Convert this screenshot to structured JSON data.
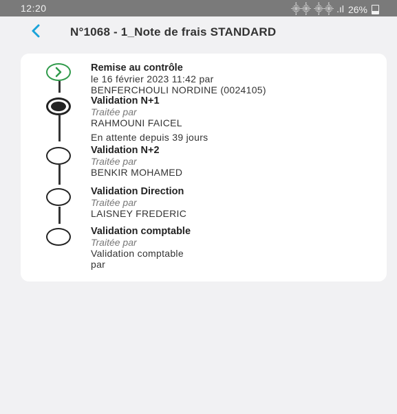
{
  "status_bar": {
    "time": "12:20",
    "indicators": "⸎⸎ ⸎⸎ .ıl 26%",
    "battery": "26%"
  },
  "header": {
    "title": "N°1068 - 1_Note de frais STANDARD",
    "back_icon": "chevron-left-icon"
  },
  "steps": [
    {
      "title": "Remise au contrôle",
      "lines": [
        "le 16 février 2023 11:42 par",
        "BENFERCHOULI NORDINE (0024105)"
      ],
      "state": "done",
      "icon": "chevron-right-circle-icon"
    },
    {
      "title": "Validation N+1",
      "subtitle": "Traitée par",
      "lines": [
        "RAHMOUNI FAICEL",
        "En attente depuis 39 jours"
      ],
      "state": "current",
      "icon": "filled-circle-icon"
    },
    {
      "title": "Validation N+2",
      "subtitle": "Traitée par",
      "lines": [
        "BENKIR MOHAMED"
      ],
      "state": "pending",
      "icon": "empty-circle-icon"
    },
    {
      "title": "Validation Direction",
      "subtitle": "Traitée par",
      "lines": [
        "LAISNEY FREDERIC"
      ],
      "state": "pending",
      "icon": "empty-circle-icon"
    },
    {
      "title": "Validation comptable",
      "subtitle": "Traitée par",
      "lines": [
        "Validation comptable",
        "par"
      ],
      "state": "pending",
      "icon": "empty-circle-icon"
    }
  ],
  "colors": {
    "accent": "#1aa3d9",
    "done": "#2f9a4a",
    "background": "#f1f1f3",
    "card": "#ffffff",
    "status_bar": "#7a7a7a"
  }
}
